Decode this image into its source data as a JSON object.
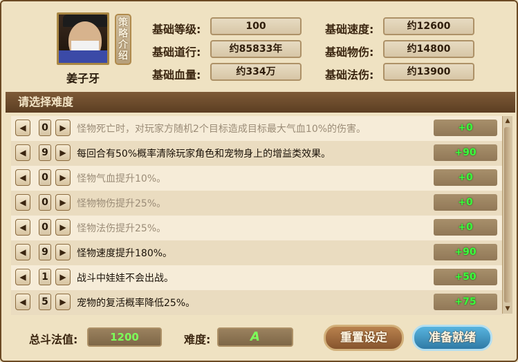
{
  "header": {
    "character_name": "姜子牙",
    "strategy_label_chars": [
      "策",
      "略",
      "介",
      "绍"
    ],
    "stats_left": [
      {
        "label": "基础等级:",
        "value": "100"
      },
      {
        "label": "基础道行:",
        "value": "约85833年"
      },
      {
        "label": "基础血量:",
        "value": "约334万"
      }
    ],
    "stats_right": [
      {
        "label": "基础速度:",
        "value": "约12600"
      },
      {
        "label": "基础物伤:",
        "value": "约14800"
      },
      {
        "label": "基础法伤:",
        "value": "约13900"
      }
    ]
  },
  "difficulty": {
    "title": "请选择难度",
    "rows": [
      {
        "level": "0",
        "text": "怪物死亡时，对玩家方随机2个目标造成目标最大气血10%的伤害。",
        "bonus": "+0",
        "active": false
      },
      {
        "level": "9",
        "text": "每回合有50%概率清除玩家角色和宠物身上的增益类效果。",
        "bonus": "+90",
        "active": true
      },
      {
        "level": "0",
        "text": "怪物气血提升10%。",
        "bonus": "+0",
        "active": false
      },
      {
        "level": "0",
        "text": "怪物物伤提升25%。",
        "bonus": "+0",
        "active": false
      },
      {
        "level": "0",
        "text": "怪物法伤提升25%。",
        "bonus": "+0",
        "active": false
      },
      {
        "level": "9",
        "text": "怪物速度提升180%。",
        "bonus": "+90",
        "active": true
      },
      {
        "level": "1",
        "text": "战斗中娃娃不会出战。",
        "bonus": "+50",
        "active": true
      },
      {
        "level": "5",
        "text": "宠物的复活概率降低25%。",
        "bonus": "+75",
        "active": true
      }
    ]
  },
  "footer": {
    "total_label": "总斗法值:",
    "total_value": "1200",
    "difficulty_label": "难度:",
    "difficulty_value": "A",
    "reset_label": "重置设定",
    "ready_label": "准备就绪"
  },
  "icons": {
    "left_arrow": "left-arrow-icon",
    "right_arrow": "right-arrow-icon",
    "scroll_up": "scroll-up-icon",
    "scroll_down": "scroll-down-icon"
  },
  "colors": {
    "bonus_text": "#3cff3c",
    "title_bar": "#6b4a2a",
    "ready_button": "#3f90c0",
    "reset_button": "#a56a3a"
  }
}
